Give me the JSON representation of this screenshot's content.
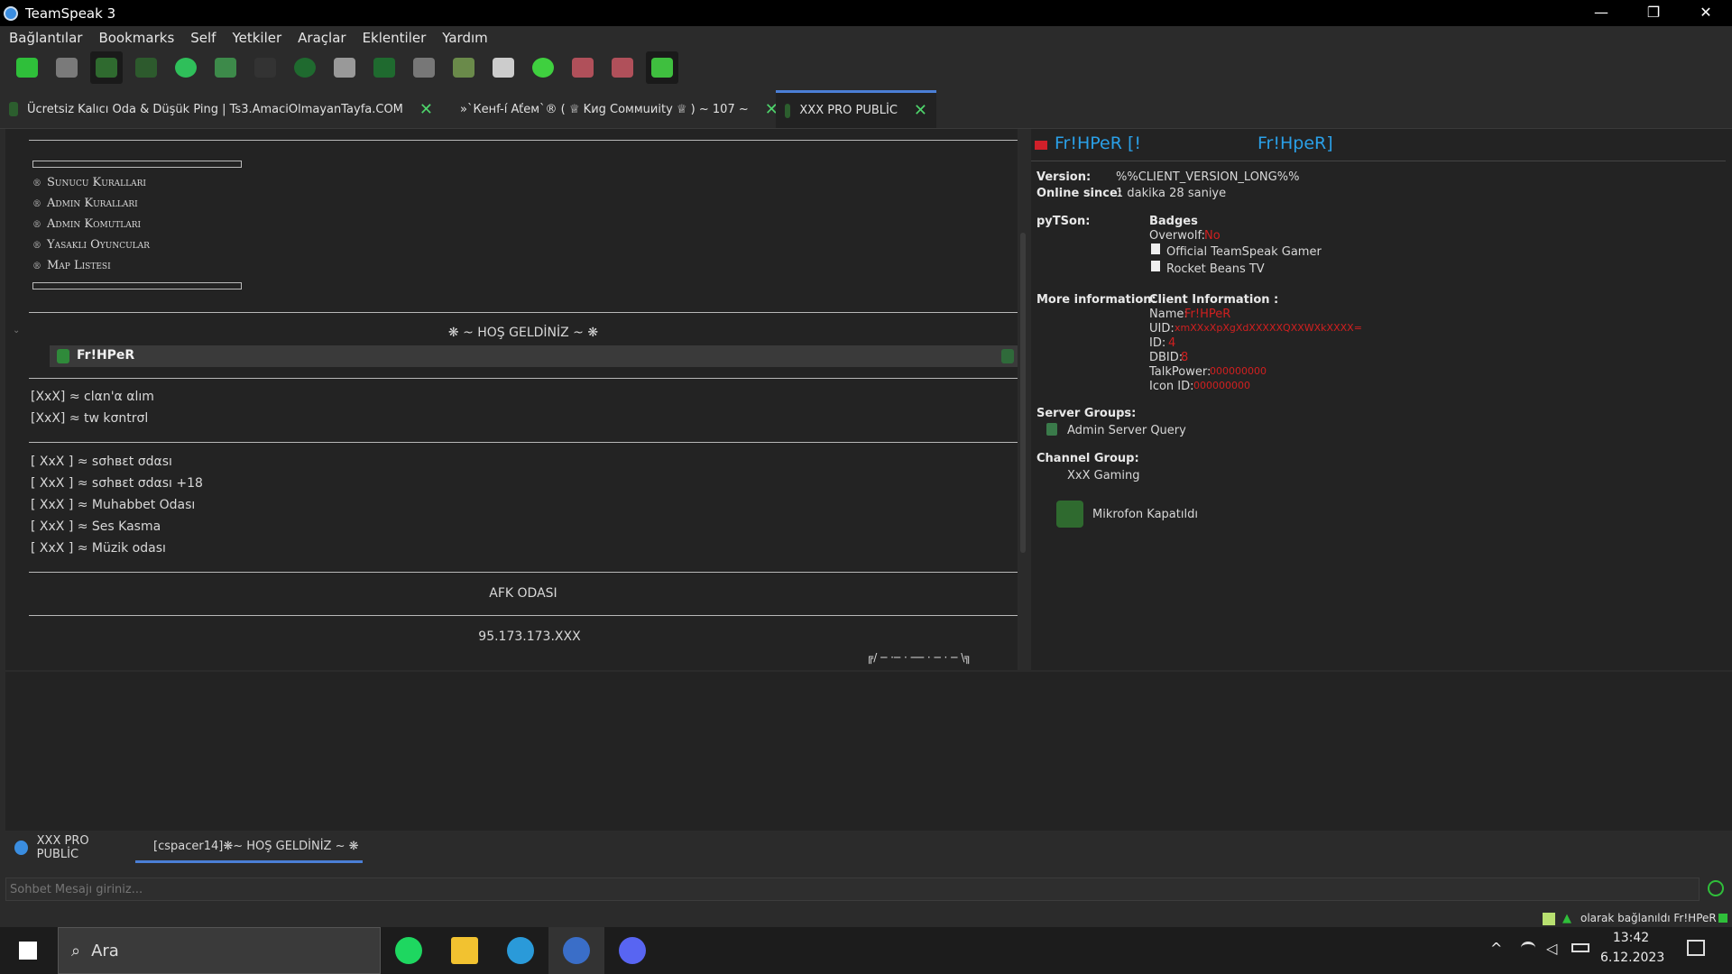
{
  "window": {
    "title": "TeamSpeak 3",
    "minimize": "—",
    "maximize": "❐",
    "close": "✕"
  },
  "menu": [
    "Bağlantılar",
    "Bookmarks",
    "Self",
    "Yetkiler",
    "Araçlar",
    "Eklentiler",
    "Yardım"
  ],
  "tabs": [
    {
      "label": "Ücretsiz Kalıcı Oda & Düşük Ping | Ts3.AmaciOlmayanTayfa.COM",
      "close": "✕"
    },
    {
      "label": "»`Кенf-í Aťeм`® ( ♕ Kиg Cоммuиity ♕ ) ~ 107 ~",
      "close": "✕"
    },
    {
      "label": "XXX PRO PUBLİC",
      "close": "✕"
    }
  ],
  "channels": {
    "rules": [
      "Sunucu Kuralları",
      "Admin Kuralları",
      "Admin Komutları",
      "Yasaklı Oyuncular",
      "Map Listesi"
    ],
    "welcome": "❋ ~ HOŞ GELDİNİZ ~ ❋",
    "user": "Fr!HPeR",
    "group1": [
      "[XxX] ≈ clαn'α αlım",
      "[XxX] ≈ tw kσntrσl"
    ],
    "group2": [
      "[ XxX ] ≈ sσhвεt σdαsı",
      "[ XxX ] ≈ sσhвεt σdαsı +18",
      "[ XxX ] ≈ Muhabbet Odası",
      "[ XxX ] ≈ Ses Kasma",
      "[ XxX ] ≈ Müzik odası"
    ],
    "afk": "AFK ODASI",
    "ip": "95.173.173.XXX",
    "spacer": "╔/ ─ ·─ · ── · ─ · ─ \\╗"
  },
  "info": {
    "name_left": "Fr!HPeR [!",
    "name_right": "Fr!HpeR]",
    "version_label": "Version:",
    "version": "%%CLIENT_VERSION_LONG%%",
    "online_label": "Online since:",
    "online": "1 dakika 28 saniye",
    "pytson_label": "pyTSon:",
    "badges_label": "Badges",
    "overwolf_label": "Overwolf:",
    "overwolf": "No",
    "badge1": "Official TeamSpeak Gamer",
    "badge2": "Rocket Beans TV",
    "more_label": "More information:",
    "client_info_label": "Client Information :",
    "name_label": "Name:",
    "name_val": "Fr!HPeR",
    "uid_label": "UID:",
    "uid_val": "xmXXxXpXgXdXXXXXQXXWXkXXXX=",
    "id_label": "ID:",
    "id_val": "4",
    "dbid_label": "DBID:",
    "dbid_val": "8",
    "talk_label": "TalkPower:",
    "talk_val": "000000000",
    "icon_label": "Icon ID:",
    "icon_val": "000000000",
    "sg_label": "Server Groups:",
    "sg_val": "Admin Server Query",
    "cg_label": "Channel Group:",
    "cg_val": "XxX Gaming",
    "mic": "Mikrofon Kapatıldı"
  },
  "chat": {
    "tab1": "XXX PRO PUBLİC",
    "tab2": "[cspacer14]❋~ HOŞ GELDİNİZ ~ ❋",
    "placeholder": "Sohbet Mesajı giriniz..."
  },
  "status": {
    "text": "olarak bağlanıldı Fr!HPeR"
  },
  "taskbar": {
    "search": "Ara",
    "time": "13:42",
    "date": "6.12.2023"
  }
}
